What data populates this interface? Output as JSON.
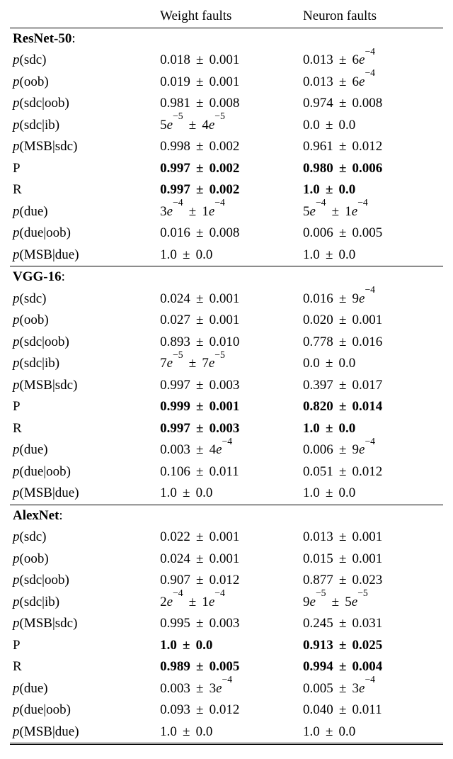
{
  "header": {
    "col1": "",
    "col2": "Weight faults",
    "col3": "Neuron faults"
  },
  "labels": {
    "p_sdc": "<span class='math'>p</span>(sdc)",
    "p_oob": "<span class='math'>p</span>(oob)",
    "p_sdc_oob": "<span class='math'>p</span>(sdc|oob)",
    "p_sdc_ib": "<span class='math'>p</span>(sdc|ib)",
    "p_msb_sdc": "<span class='math'>p</span>(MSB|sdc)",
    "P": "P",
    "R": "R",
    "p_due": "<span class='math'>p</span>(due)",
    "p_due_oob": "<span class='math'>p</span>(due|oob)",
    "p_msb_due": "<span class='math'>p</span>(MSB|due)"
  },
  "sections": [
    {
      "title": "ResNet-50",
      "rows": [
        {
          "k": "p_sdc",
          "w": "0.018 ± 0.001",
          "n": "0.013 ± 6<span class='math'>e</span><sup>−4</sup>"
        },
        {
          "k": "p_oob",
          "w": "0.019 ± 0.001",
          "n": "0.013 ± 6<span class='math'>e</span><sup>−4</sup>"
        },
        {
          "k": "p_sdc_oob",
          "w": "0.981 ± 0.008",
          "n": "0.974 ± 0.008"
        },
        {
          "k": "p_sdc_ib",
          "w": "5<span class='math'>e</span><sup>−5</sup> ± 4<span class='math'>e</span><sup>−5</sup>",
          "n": "0.0 ± 0.0"
        },
        {
          "k": "p_msb_sdc",
          "w": "0.998 ± 0.002",
          "n": "0.961 ± 0.012"
        },
        {
          "k": "P",
          "bold": true,
          "w": "0.997 ± 0.002",
          "n": "0.980 ± 0.006"
        },
        {
          "k": "R",
          "bold": true,
          "w": "0.997 ± 0.002",
          "n": "1.0 ± 0.0"
        },
        {
          "k": "p_due",
          "w": "3<span class='math'>e</span><sup>−4</sup> ± 1<span class='math'>e</span><sup>−4</sup>",
          "n": "5<span class='math'>e</span><sup>−4</sup> ± 1<span class='math'>e</span><sup>−4</sup>"
        },
        {
          "k": "p_due_oob",
          "w": "0.016 ± 0.008",
          "n": "0.006 ± 0.005"
        },
        {
          "k": "p_msb_due",
          "w": "1.0 ± 0.0",
          "n": "1.0 ± 0.0"
        }
      ]
    },
    {
      "title": "VGG-16",
      "rows": [
        {
          "k": "p_sdc",
          "w": "0.024 ± 0.001",
          "n": "0.016 ± 9<span class='math'>e</span><sup>−4</sup>"
        },
        {
          "k": "p_oob",
          "w": "0.027 ± 0.001",
          "n": "0.020 ± 0.001"
        },
        {
          "k": "p_sdc_oob",
          "w": "0.893 ± 0.010",
          "n": "0.778 ± 0.016"
        },
        {
          "k": "p_sdc_ib",
          "w": "7<span class='math'>e</span><sup>−5</sup> ± 7<span class='math'>e</span><sup>−5</sup>",
          "n": "0.0 ± 0.0"
        },
        {
          "k": "p_msb_sdc",
          "w": "0.997 ± 0.003",
          "n": "0.397 ± 0.017"
        },
        {
          "k": "P",
          "bold": true,
          "w": "0.999 ± 0.001",
          "n": "0.820 ± 0.014"
        },
        {
          "k": "R",
          "bold": true,
          "w": "0.997 ± 0.003",
          "n": "1.0 ± 0.0"
        },
        {
          "k": "p_due",
          "w": "0.003 ± 4<span class='math'>e</span><sup>−4</sup>",
          "n": "0.006 ± 9<span class='math'>e</span><sup>−4</sup>"
        },
        {
          "k": "p_due_oob",
          "w": "0.106 ± 0.011",
          "n": "0.051 ± 0.012"
        },
        {
          "k": "p_msb_due",
          "w": "1.0 ± 0.0",
          "n": "1.0 ± 0.0"
        }
      ]
    },
    {
      "title": "AlexNet",
      "rows": [
        {
          "k": "p_sdc",
          "w": "0.022 ± 0.001",
          "n": "0.013 ± 0.001"
        },
        {
          "k": "p_oob",
          "w": "0.024 ± 0.001",
          "n": "0.015 ± 0.001"
        },
        {
          "k": "p_sdc_oob",
          "w": "0.907 ± 0.012",
          "n": "0.877 ± 0.023"
        },
        {
          "k": "p_sdc_ib",
          "w": "2<span class='math'>e</span><sup>−4</sup> ± 1<span class='math'>e</span><sup>−4</sup>",
          "n": "9<span class='math'>e</span><sup>−5</sup> ± 5<span class='math'>e</span><sup>−5</sup>"
        },
        {
          "k": "p_msb_sdc",
          "w": "0.995 ± 0.003",
          "n": "0.245 ± 0.031"
        },
        {
          "k": "P",
          "bold": true,
          "w": "1.0 ± 0.0",
          "n": "0.913 ± 0.025"
        },
        {
          "k": "R",
          "bold": true,
          "w": "0.989 ± 0.005",
          "n": "0.994 ± 0.004"
        },
        {
          "k": "p_due",
          "w": "0.003 ± 3<span class='math'>e</span><sup>−4</sup>",
          "n": "0.005 ± 3<span class='math'>e</span><sup>−4</sup>"
        },
        {
          "k": "p_due_oob",
          "w": "0.093 ± 0.012",
          "n": "0.040 ± 0.011"
        },
        {
          "k": "p_msb_due",
          "w": "1.0 ± 0.0",
          "n": "1.0 ± 0.0"
        }
      ]
    }
  ]
}
